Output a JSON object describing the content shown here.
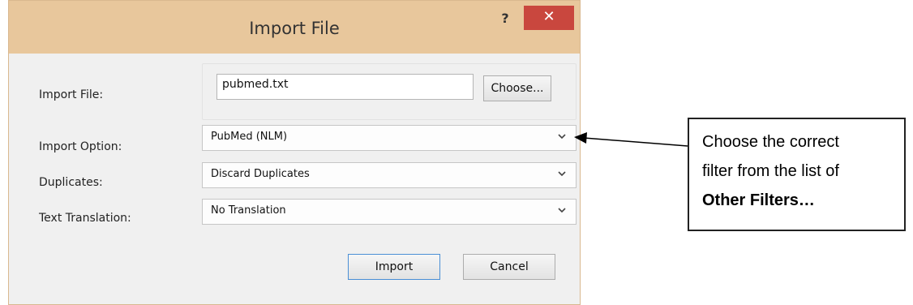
{
  "window": {
    "title": "Import File",
    "help_label": "?",
    "close_label": "✕"
  },
  "fields": {
    "import_file": {
      "label": "Import File:",
      "value": "pubmed.txt",
      "choose_label": "Choose..."
    },
    "import_option": {
      "label": "Import Option:",
      "value": "PubMed (NLM)"
    },
    "duplicates": {
      "label": "Duplicates:",
      "value": "Discard Duplicates"
    },
    "text_translation": {
      "label": "Text Translation:",
      "value": "No Translation"
    }
  },
  "buttons": {
    "import_label": "Import",
    "cancel_label": "Cancel"
  },
  "callout": {
    "text_line1": "Choose the correct",
    "text_line2": "filter from the list of",
    "text_bold": "Other Filters…"
  },
  "icons": {
    "help": "question-mark-icon",
    "close": "close-icon",
    "dropdown": "chevron-down-icon",
    "arrow": "arrow-left-icon"
  },
  "colors": {
    "titlebar": "#e8c79c",
    "close_button": "#c9473e",
    "dialog_bg": "#f0f0f0"
  }
}
